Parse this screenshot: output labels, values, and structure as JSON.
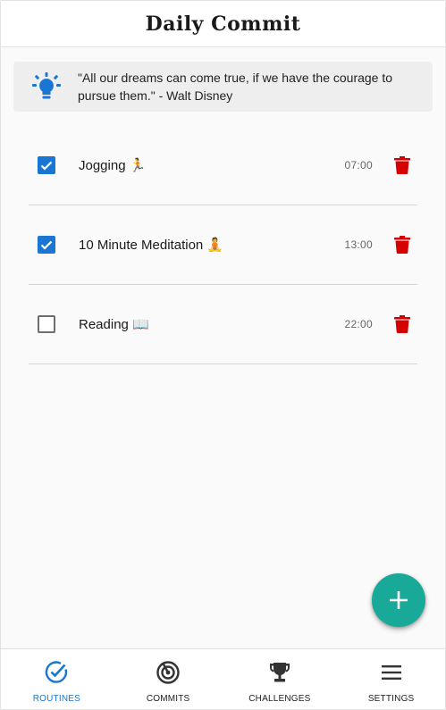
{
  "header": {
    "title": "Daily Commit"
  },
  "quote": {
    "icon": "lightbulb-icon",
    "text": "\"All our dreams can come true, if we have the courage to pursue them.\" - Walt Disney"
  },
  "routines": [
    {
      "name": "Jogging 🏃",
      "time": "07:00",
      "checked": true
    },
    {
      "name": "10 Minute Meditation 🧘",
      "time": "13:00",
      "checked": true
    },
    {
      "name": "Reading 📖",
      "time": "22:00",
      "checked": false
    }
  ],
  "fab": {
    "icon": "plus-icon"
  },
  "nav": [
    {
      "label": "ROUTINES",
      "icon": "check-circle-icon",
      "active": true
    },
    {
      "label": "COMMITS",
      "icon": "radar-icon",
      "active": false
    },
    {
      "label": "CHALLENGES",
      "icon": "trophy-icon",
      "active": false
    },
    {
      "label": "SETTINGS",
      "icon": "menu-icon",
      "active": false
    }
  ],
  "colors": {
    "primary": "#1976d2",
    "delete": "#d50000",
    "fab": "#18a999"
  }
}
